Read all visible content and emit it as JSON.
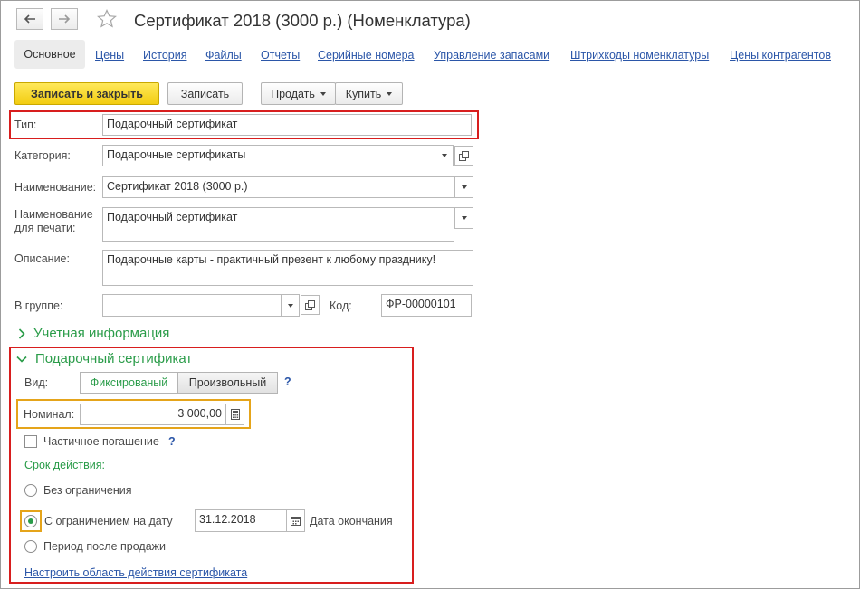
{
  "window": {
    "title": "Сертификат 2018 (3000 р.) (Номенклатура)"
  },
  "tabs": {
    "active": "Основное",
    "items": [
      "Цены",
      "История",
      "Файлы",
      "Отчеты",
      "Серийные номера",
      "Управление запасами",
      "Штрихкоды номенклатуры",
      "Цены контрагентов"
    ]
  },
  "toolbar": {
    "save_close": "Записать и закрыть",
    "save": "Записать",
    "sell": "Продать",
    "buy": "Купить"
  },
  "form": {
    "type_label": "Тип:",
    "type_value": "Подарочный сертификат",
    "category_label": "Категория:",
    "category_value": "Подарочные сертификаты",
    "name_label": "Наименование:",
    "name_value": "Сертификат 2018 (3000 р.)",
    "print_name_label_1": "Наименование",
    "print_name_label_2": "для печати:",
    "print_name_value": "Подарочный сертификат",
    "description_label": "Описание:",
    "description_value": "Подарочные карты - практичный презент к любому празднику!",
    "group_label": "В группе:",
    "group_value": "",
    "code_label": "Код:",
    "code_value": "ФР-00000101"
  },
  "sections": {
    "accounting": "Учетная информация",
    "gift_cert": "Подарочный сертификат"
  },
  "gift": {
    "kind_label": "Вид:",
    "kind_fixed": "Фиксированый",
    "kind_custom": "Произвольный",
    "help": "?",
    "nominal_label": "Номинал:",
    "nominal_value": "3 000,00",
    "partial_label": "Частичное погашение",
    "validity_label": "Срок действия:",
    "opt_unlimited": "Без ограничения",
    "opt_date": "С ограничением на дату",
    "date_value": "31.12.2018",
    "date_end_label": "Дата окончания",
    "opt_period": "Период после продажи",
    "configure_link": "Настроить область действия сертификата",
    "selected_option": "С ограничением на дату",
    "partial_checked": false
  },
  "colors": {
    "accent_green": "#2a9c49",
    "link_blue": "#2b56a8",
    "highlight_red": "#d81e1e",
    "highlight_orange": "#e5a41a",
    "primary_yellow": "#f2cc10"
  }
}
